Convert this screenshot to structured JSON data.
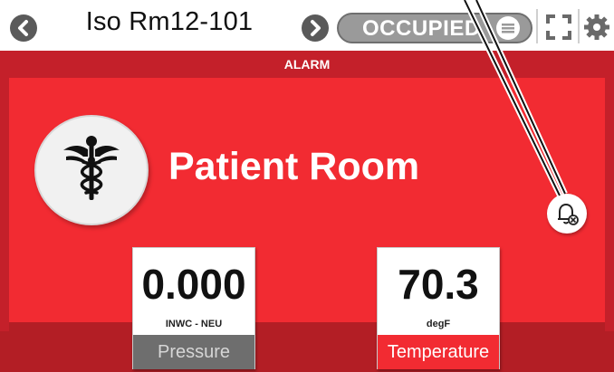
{
  "header": {
    "room_name": "Iso Rm12-101",
    "status": "OCCUPIED",
    "icons": {
      "prev": "chevron-left-icon",
      "next": "chevron-right-icon",
      "menu": "hamburger-menu-icon",
      "fullscreen": "fullscreen-icon",
      "settings": "gear-icon"
    }
  },
  "alarm": {
    "label": "ALARM"
  },
  "room": {
    "type": "Patient Room",
    "icon": "caduceus-icon"
  },
  "alarm_silence": {
    "icon": "bell-off-icon"
  },
  "readings": [
    {
      "value": "0.000",
      "unit": "INWC - NEU",
      "label": "Pressure",
      "state": "normal"
    },
    {
      "value": "70.3",
      "unit": "degF",
      "label": "Temperature",
      "state": "alarm"
    }
  ],
  "colors": {
    "alarm_red": "#f22b32",
    "alarm_dark_red": "#c4202a",
    "status_pill": "#9a9a9a",
    "normal_label": "#6e6e6e"
  }
}
